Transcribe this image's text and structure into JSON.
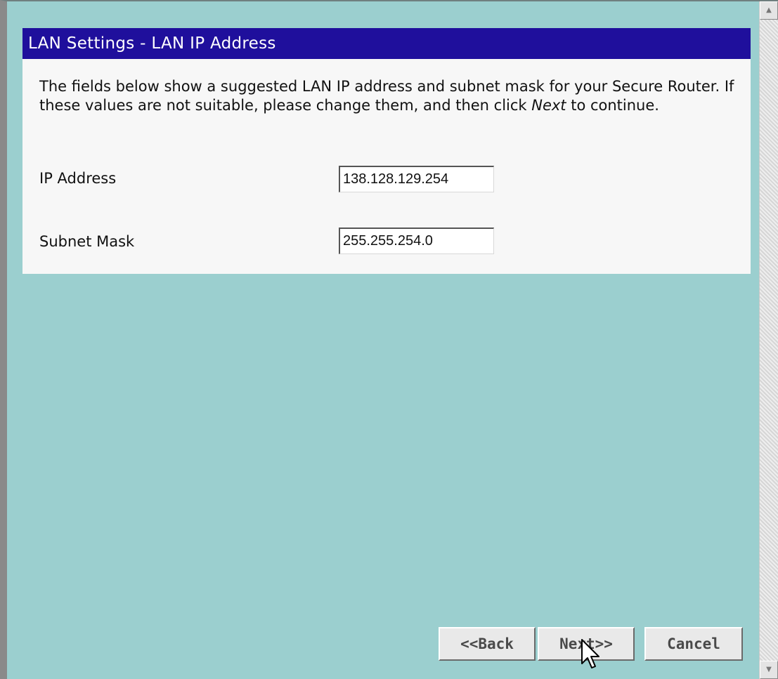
{
  "header": {
    "title": "LAN Settings - LAN IP Address"
  },
  "panel": {
    "description_part1": "The fields below show a suggested LAN IP address and subnet mask for your Secure Router. If these values are not suitable, please change them, and then click ",
    "description_emph": "Next",
    "description_part2": " to continue.",
    "fields": [
      {
        "label": "IP Address",
        "value": "138.128.129.254"
      },
      {
        "label": "Subnet Mask",
        "value": "255.255.254.0"
      }
    ]
  },
  "buttons": {
    "back_label": "<<Back",
    "next_label": "Next>>",
    "cancel_label": "Cancel"
  },
  "colors": {
    "background": "#9bcfcf",
    "header": "#1f0f9c"
  },
  "icons": {
    "scroll_up": "scroll-up-arrow-icon",
    "scroll_down": "scroll-down-arrow-icon",
    "cursor": "mouse-pointer-icon"
  }
}
